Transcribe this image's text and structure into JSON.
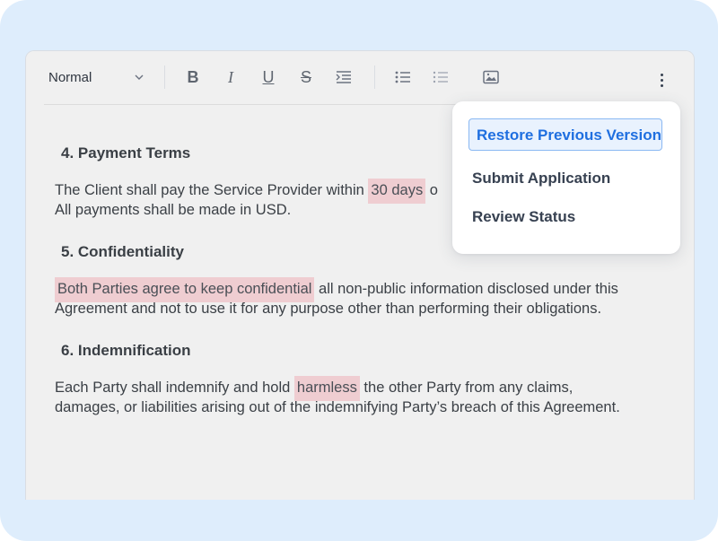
{
  "toolbar": {
    "style_value": "Normal",
    "bold_label": "B",
    "italic_label": "I",
    "underline_label": "U",
    "strike_label": "S"
  },
  "document": {
    "sections": [
      {
        "heading": "4. Payment Terms",
        "pre": "The Client shall pay the Service Provider within ",
        "highlight": "30 days",
        "post": " o",
        "line2": "All payments shall be made in USD."
      },
      {
        "heading": "5. Confidentiality",
        "highlight": "Both Parties agree to keep confidential",
        "post": " all non-public information disclosed under this Agreement and not to use it for any purpose other than performing their obligations."
      },
      {
        "heading": "6. Indemnification",
        "pre": "Each Party shall indemnify and hold ",
        "highlight": "harmless",
        "post": " the other Party from any claims, damages, or liabilities arising out of the indemnifying Party’s breach of this Agreement."
      }
    ]
  },
  "menu": {
    "items": [
      {
        "label": "Restore Previous Version",
        "active": true
      },
      {
        "label": "Submit Application",
        "active": false
      },
      {
        "label": "Review Status",
        "active": false
      }
    ]
  },
  "colors": {
    "background": "#deedfc",
    "highlight": "#efcdd1",
    "accent": "#1f6fe0"
  }
}
